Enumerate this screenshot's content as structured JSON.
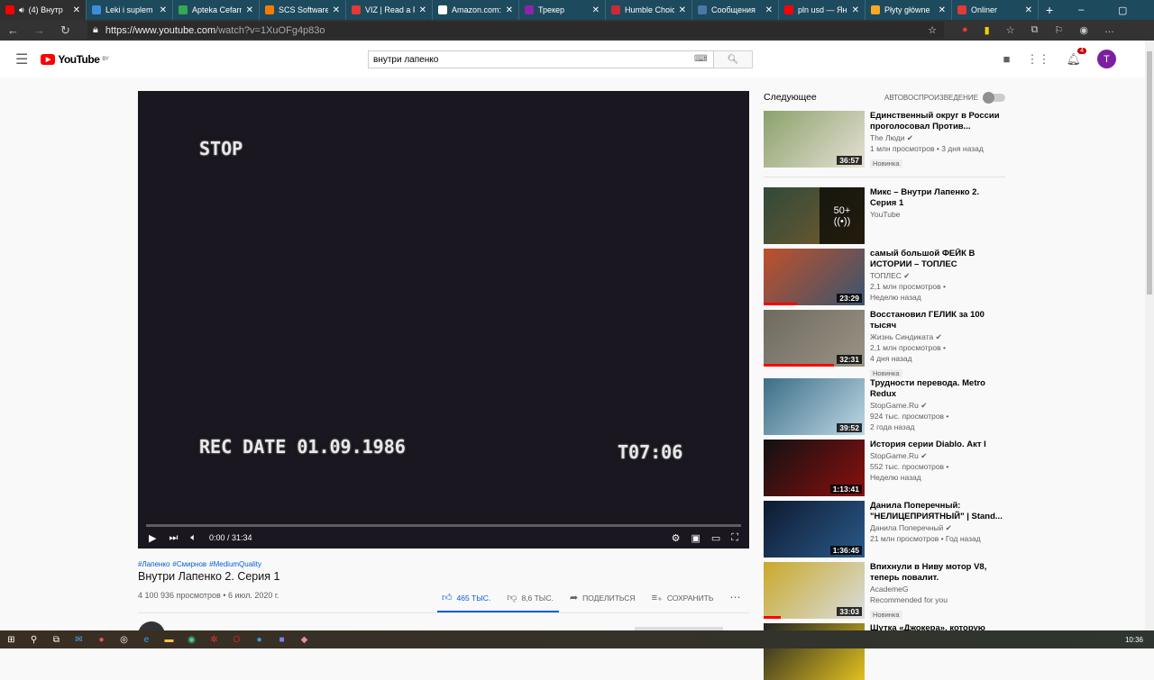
{
  "browser": {
    "tabs": [
      {
        "title": "(4) Внутр",
        "color": "#ff0000",
        "active": true
      },
      {
        "title": "Leki i suplem",
        "color": "#3a8fd6"
      },
      {
        "title": "Apteka Cefarm",
        "color": "#34a853"
      },
      {
        "title": "SCS Software",
        "color": "#f57c00"
      },
      {
        "title": "VIZ | Read a F",
        "color": "#e53935"
      },
      {
        "title": "Amazon.com:",
        "color": "#ffffff"
      },
      {
        "title": "Трекер",
        "color": "#8e24aa"
      },
      {
        "title": "Humble Choic",
        "color": "#cc2936"
      },
      {
        "title": "Сообщения",
        "color": "#4a76a8"
      },
      {
        "title": "pln usd — Ян",
        "color": "#ff0000"
      },
      {
        "title": "Płyty główne",
        "color": "#f9a825"
      },
      {
        "title": "Onliner",
        "color": "#e53935"
      }
    ],
    "url_host": "https://www.youtube.com",
    "url_path": "/watch?v=1XuOFg4p83o"
  },
  "header": {
    "logo": "YouTube",
    "region": "BY",
    "search_value": "внутри лапенко",
    "notif_count": "4",
    "avatar_letter": "T"
  },
  "player": {
    "osd_top": "STOP",
    "osd_date": "REC DATE 01.09.1986",
    "osd_time": "T07:06",
    "time": "0:00 / 31:34",
    "progress": 0
  },
  "video": {
    "hashtags": [
      "#Лапенко",
      "#Смирнов",
      "#MediumQuality"
    ],
    "title": "Внутри Лапенко 2. Серия 1",
    "views": "4 100 936 просмотров • 6 июл. 2020 г.",
    "likes": "465 ТЫС.",
    "dislikes": "8,6 ТЫС.",
    "share": "ПОДЕЛИТЬСЯ",
    "save": "СОХРАНИТЬ"
  },
  "sidebar": {
    "next_label": "Следующее",
    "autoplay_label": "АВТОВОСПРОИЗВЕДЕНИЕ",
    "items": [
      {
        "title": "Единственный округ в России проголосовал Против...",
        "channel": "The Люди",
        "verified": true,
        "views": "1 млн просмотров • 3 дня назад",
        "badge": "Новинка",
        "duration": "36:57",
        "colors": [
          "#8aa26a",
          "#e6e0d5"
        ],
        "watched": 0
      },
      {
        "title": "Микс – Внутри Лапенко 2. Серия 1",
        "channel": "YouTube",
        "views": "",
        "duration": "",
        "mix": "50+",
        "colors": [
          "#2f4a3a",
          "#7a5a2c"
        ],
        "watched": 0
      },
      {
        "title": "самый большой ФЕЙК В ИСТОРИИ – ТОПЛЕС",
        "channel": "ТОПЛЕС",
        "verified": true,
        "views": "2,1 млн просмотров •",
        "age": "Неделю назад",
        "duration": "23:29",
        "colors": [
          "#c0502a",
          "#3a5570"
        ],
        "watched": 0.33
      },
      {
        "title": "Восстановил ГЕЛИК за 100 тысяч",
        "channel": "Жизнь Синдиката",
        "verified": true,
        "views": "2,1 млн просмотров •",
        "age": "4 дня назад",
        "badge": "Новинка",
        "duration": "32:31",
        "colors": [
          "#6e6a5e",
          "#9a9486"
        ],
        "watched": 0.7
      },
      {
        "title": "Трудности перевода. Metro Redux",
        "channel": "StopGame.Ru",
        "verified": true,
        "views": "924 тыс. просмотров •",
        "age": "2 года назад",
        "duration": "39:52",
        "colors": [
          "#3b6e88",
          "#bfd8e4"
        ],
        "watched": 0
      },
      {
        "title": "История серии Diablo. Акт I",
        "channel": "StopGame.Ru",
        "verified": true,
        "views": "552 тыс. просмотров •",
        "age": "Неделю назад",
        "duration": "1:13:41",
        "colors": [
          "#111111",
          "#8b1010"
        ],
        "watched": 0
      },
      {
        "title": "Данила Поперечный: \"НЕЛИЦЕПРИЯТНЫЙ\" | Stand...",
        "channel": "Данила Поперечный",
        "verified": true,
        "views": "21 млн просмотров • Год назад",
        "duration": "1:36:45",
        "colors": [
          "#0e1a30",
          "#2a5a8a"
        ],
        "watched": 0
      },
      {
        "title": "Впихнули в Ниву мотор V8, теперь повалит.",
        "channel": "AcademeG",
        "views": "Recommended for you",
        "badge": "Новинка",
        "duration": "33:03",
        "colors": [
          "#c9a92a",
          "#d9dde0"
        ],
        "watched": 0.17
      },
      {
        "title": "Шутка «Джокера», которую",
        "channel": "",
        "views": "",
        "duration": "",
        "colors": [
          "#222",
          "#e0c020"
        ],
        "watched": 0
      }
    ]
  },
  "taskbar": {
    "clock": "10:36"
  }
}
